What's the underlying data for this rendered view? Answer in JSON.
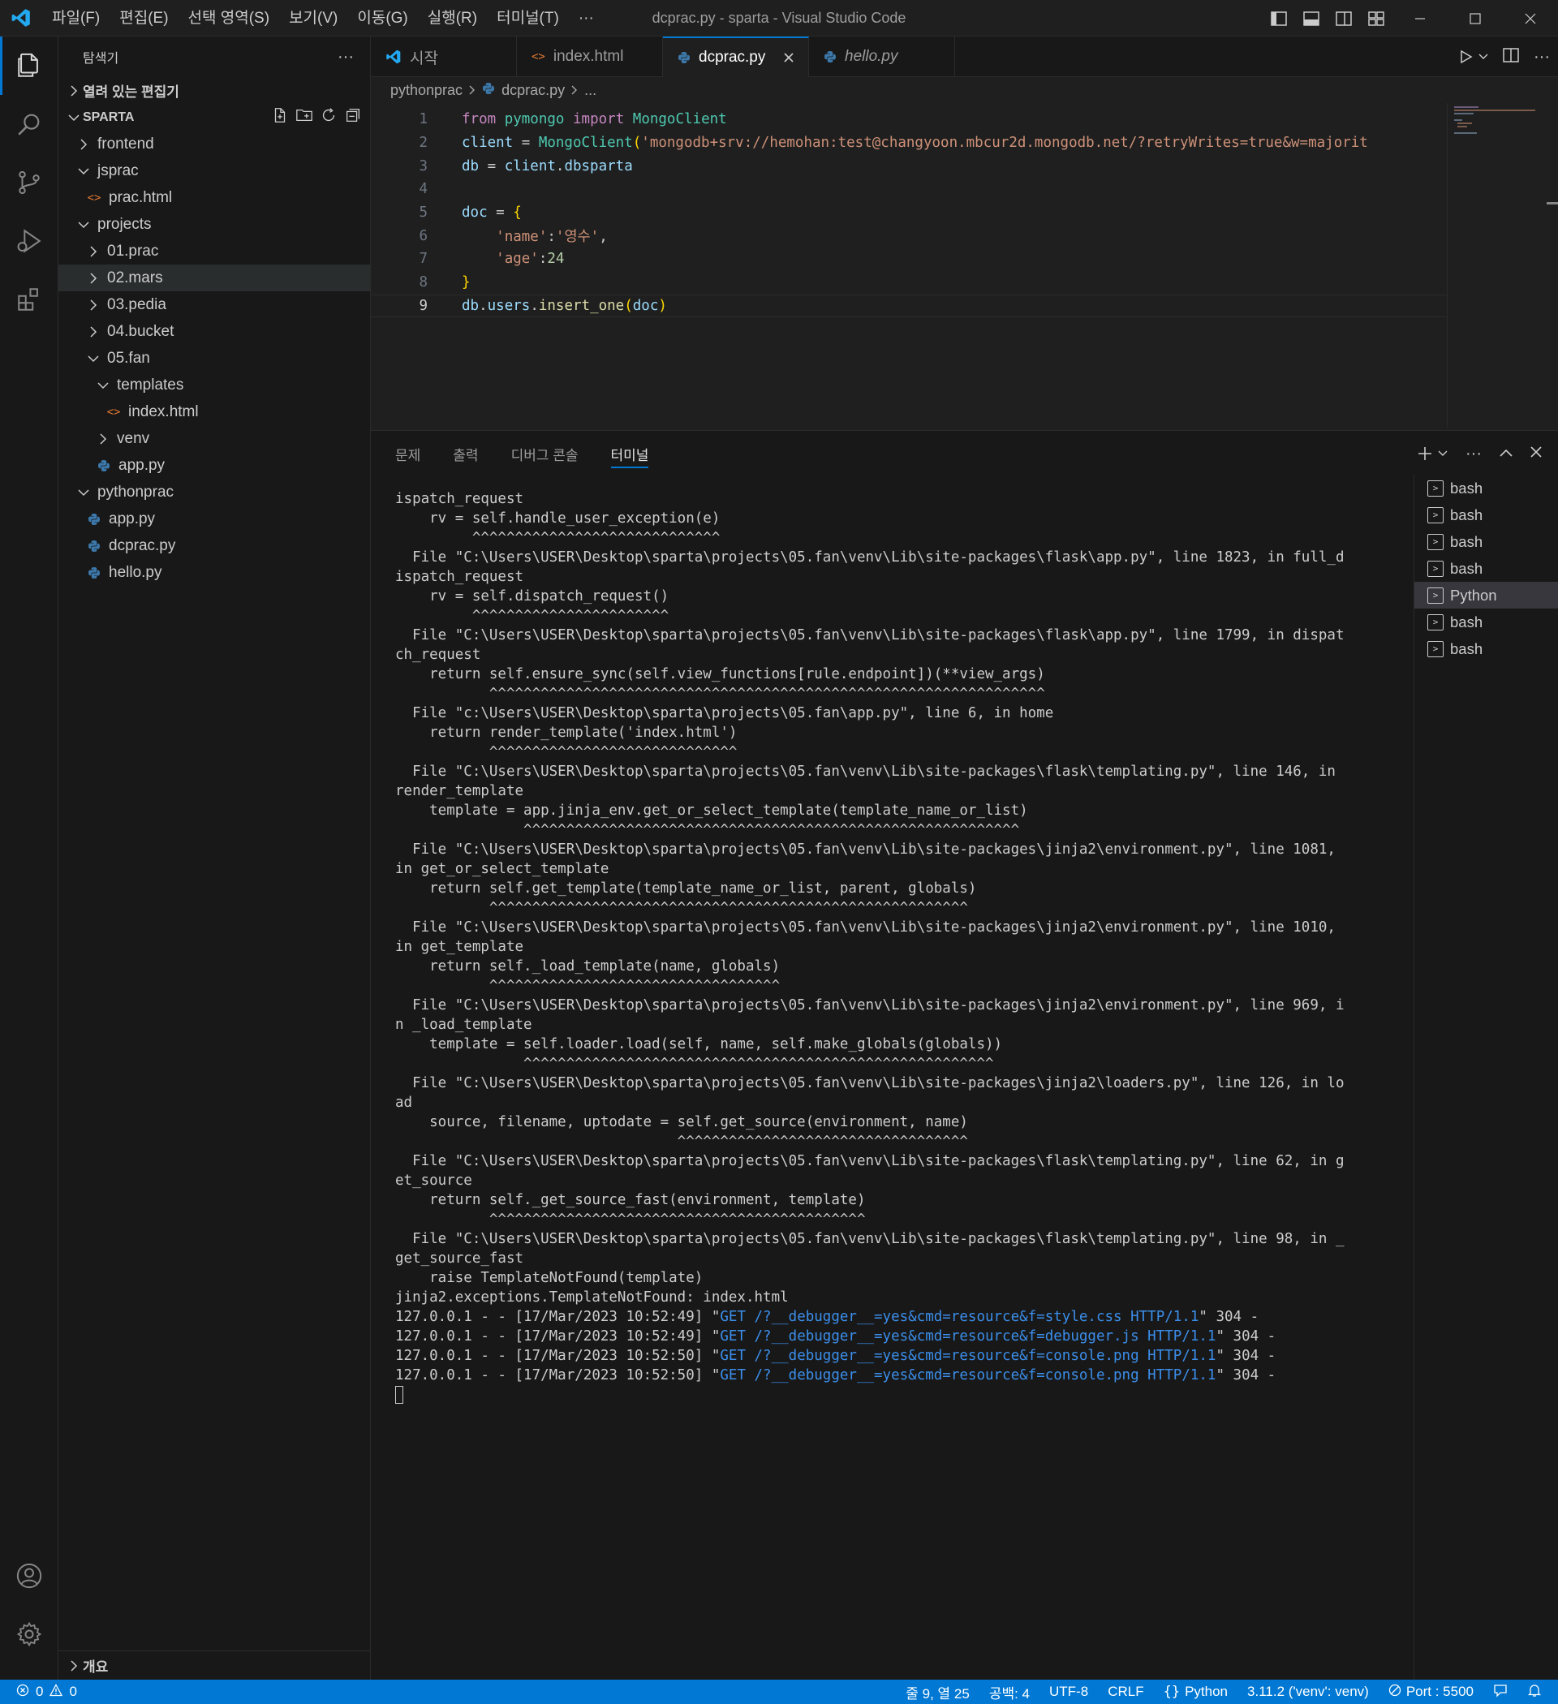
{
  "titlebar": {
    "menu": [
      "파일(F)",
      "편집(E)",
      "선택 영역(S)",
      "보기(V)",
      "이동(G)",
      "실행(R)",
      "터미널(T)",
      "···"
    ],
    "title": "dcprac.py - sparta - Visual Studio Code"
  },
  "activitybar": {
    "items": [
      "explorer-icon",
      "search-icon",
      "source-control-icon",
      "run-debug-icon",
      "extensions-icon"
    ],
    "bottom": [
      "account-icon",
      "gear-icon"
    ]
  },
  "sidebar": {
    "header": "탐색기",
    "more": "···",
    "open_editors": "열려 있는 편집기",
    "root": "SPARTA",
    "outline": "개요",
    "tree": [
      {
        "label": "frontend",
        "type": "folder",
        "open": false,
        "depth": 1
      },
      {
        "label": "jsprac",
        "type": "folder",
        "open": true,
        "depth": 1
      },
      {
        "label": "prac.html",
        "type": "html",
        "depth": 2
      },
      {
        "label": "projects",
        "type": "folder",
        "open": true,
        "depth": 1
      },
      {
        "label": "01.prac",
        "type": "folder",
        "open": false,
        "depth": 2
      },
      {
        "label": "02.mars",
        "type": "folder",
        "open": false,
        "depth": 2,
        "hover": true
      },
      {
        "label": "03.pedia",
        "type": "folder",
        "open": false,
        "depth": 2
      },
      {
        "label": "04.bucket",
        "type": "folder",
        "open": false,
        "depth": 2
      },
      {
        "label": "05.fan",
        "type": "folder",
        "open": true,
        "depth": 2
      },
      {
        "label": "templates",
        "type": "folder",
        "open": true,
        "depth": 3
      },
      {
        "label": "index.html",
        "type": "html",
        "depth": 4
      },
      {
        "label": "venv",
        "type": "folder",
        "open": false,
        "depth": 3
      },
      {
        "label": "app.py",
        "type": "py",
        "depth": 3
      },
      {
        "label": "pythonprac",
        "type": "folder",
        "open": true,
        "depth": 1
      },
      {
        "label": "app.py",
        "type": "py",
        "depth": 2
      },
      {
        "label": "dcprac.py",
        "type": "py",
        "depth": 2
      },
      {
        "label": "hello.py",
        "type": "py",
        "depth": 2
      }
    ]
  },
  "tabs": [
    {
      "label": "시작",
      "icon": "vscode",
      "active": false,
      "italic": false
    },
    {
      "label": "index.html",
      "icon": "html",
      "active": false,
      "italic": false
    },
    {
      "label": "dcprac.py",
      "icon": "py",
      "active": true,
      "italic": false
    },
    {
      "label": "hello.py",
      "icon": "py",
      "active": false,
      "italic": true
    }
  ],
  "breadcrumb": {
    "folder": "pythonprac",
    "file": "dcprac.py",
    "more": "..."
  },
  "code": {
    "current_line": 9,
    "line_numbers": [
      "1",
      "2",
      "3",
      "4",
      "5",
      "6",
      "7",
      "8",
      "9"
    ]
  },
  "panel": {
    "tabs": [
      "문제",
      "출력",
      "디버그 콘솔",
      "터미널"
    ],
    "active_tab": "터미널",
    "terminal_lines": [
      "ispatch_request",
      "    rv = self.handle_user_exception(e)",
      "         ^^^^^^^^^^^^^^^^^^^^^^^^^^^^^",
      "  File \"C:\\Users\\USER\\Desktop\\sparta\\projects\\05.fan\\venv\\Lib\\site-packages\\flask\\app.py\", line 1823, in full_d",
      "ispatch_request",
      "    rv = self.dispatch_request()",
      "         ^^^^^^^^^^^^^^^^^^^^^^^",
      "  File \"C:\\Users\\USER\\Desktop\\sparta\\projects\\05.fan\\venv\\Lib\\site-packages\\flask\\app.py\", line 1799, in dispat",
      "ch_request",
      "    return self.ensure_sync(self.view_functions[rule.endpoint])(**view_args)",
      "           ^^^^^^^^^^^^^^^^^^^^^^^^^^^^^^^^^^^^^^^^^^^^^^^^^^^^^^^^^^^^^^^^^",
      "  File \"c:\\Users\\USER\\Desktop\\sparta\\projects\\05.fan\\app.py\", line 6, in home",
      "    return render_template('index.html')",
      "           ^^^^^^^^^^^^^^^^^^^^^^^^^^^^^",
      "  File \"C:\\Users\\USER\\Desktop\\sparta\\projects\\05.fan\\venv\\Lib\\site-packages\\flask\\templating.py\", line 146, in",
      "render_template",
      "    template = app.jinja_env.get_or_select_template(template_name_or_list)",
      "               ^^^^^^^^^^^^^^^^^^^^^^^^^^^^^^^^^^^^^^^^^^^^^^^^^^^^^^^^^^",
      "  File \"C:\\Users\\USER\\Desktop\\sparta\\projects\\05.fan\\venv\\Lib\\site-packages\\jinja2\\environment.py\", line 1081,",
      "in get_or_select_template",
      "    return self.get_template(template_name_or_list, parent, globals)",
      "           ^^^^^^^^^^^^^^^^^^^^^^^^^^^^^^^^^^^^^^^^^^^^^^^^^^^^^^^^",
      "  File \"C:\\Users\\USER\\Desktop\\sparta\\projects\\05.fan\\venv\\Lib\\site-packages\\jinja2\\environment.py\", line 1010,",
      "in get_template",
      "    return self._load_template(name, globals)",
      "           ^^^^^^^^^^^^^^^^^^^^^^^^^^^^^^^^^^",
      "  File \"C:\\Users\\USER\\Desktop\\sparta\\projects\\05.fan\\venv\\Lib\\site-packages\\jinja2\\environment.py\", line 969, i",
      "n _load_template",
      "    template = self.loader.load(self, name, self.make_globals(globals))",
      "               ^^^^^^^^^^^^^^^^^^^^^^^^^^^^^^^^^^^^^^^^^^^^^^^^^^^^^^^",
      "  File \"C:\\Users\\USER\\Desktop\\sparta\\projects\\05.fan\\venv\\Lib\\site-packages\\jinja2\\loaders.py\", line 126, in lo",
      "ad",
      "    source, filename, uptodate = self.get_source(environment, name)",
      "                                 ^^^^^^^^^^^^^^^^^^^^^^^^^^^^^^^^^^",
      "  File \"C:\\Users\\USER\\Desktop\\sparta\\projects\\05.fan\\venv\\Lib\\site-packages\\flask\\templating.py\", line 62, in g",
      "et_source",
      "    return self._get_source_fast(environment, template)",
      "           ^^^^^^^^^^^^^^^^^^^^^^^^^^^^^^^^^^^^^^^^^^^^",
      "  File \"C:\\Users\\USER\\Desktop\\sparta\\projects\\05.fan\\venv\\Lib\\site-packages\\flask\\templating.py\", line 98, in _",
      "get_source_fast",
      "    raise TemplateNotFound(template)",
      "jinja2.exceptions.TemplateNotFound: index.html"
    ],
    "log_lines": [
      {
        "prefix": "127.0.0.1 - - [17/Mar/2023 10:52:49] \"",
        "link": "GET /?__debugger__=yes&cmd=resource&f=style.css HTTP/1.1",
        "suffix": "\" 304 -"
      },
      {
        "prefix": "127.0.0.1 - - [17/Mar/2023 10:52:49] \"",
        "link": "GET /?__debugger__=yes&cmd=resource&f=debugger.js HTTP/1.1",
        "suffix": "\" 304 -"
      },
      {
        "prefix": "127.0.0.1 - - [17/Mar/2023 10:52:50] \"",
        "link": "GET /?__debugger__=yes&cmd=resource&f=console.png HTTP/1.1",
        "suffix": "\" 304 -"
      },
      {
        "prefix": "127.0.0.1 - - [17/Mar/2023 10:52:50] \"",
        "link": "GET /?__debugger__=yes&cmd=resource&f=console.png HTTP/1.1",
        "suffix": "\" 304 -"
      }
    ],
    "terminals": [
      {
        "label": "bash",
        "active": false
      },
      {
        "label": "bash",
        "active": false
      },
      {
        "label": "bash",
        "active": false
      },
      {
        "label": "bash",
        "active": false
      },
      {
        "label": "Python",
        "active": true
      },
      {
        "label": "bash",
        "active": false
      },
      {
        "label": "bash",
        "active": false
      }
    ]
  },
  "statusbar": {
    "errors": "0",
    "warnings": "0",
    "position": "줄 9, 열 25",
    "indent": "공백: 4",
    "encoding": "UTF-8",
    "eol": "CRLF",
    "language": "Python",
    "interpreter": "3.11.2 ('venv': venv)",
    "port": "Port : 5500"
  },
  "colors": {
    "accent": "#0078d4",
    "statusbar": "#0078d4",
    "link": "#3b8eea"
  }
}
